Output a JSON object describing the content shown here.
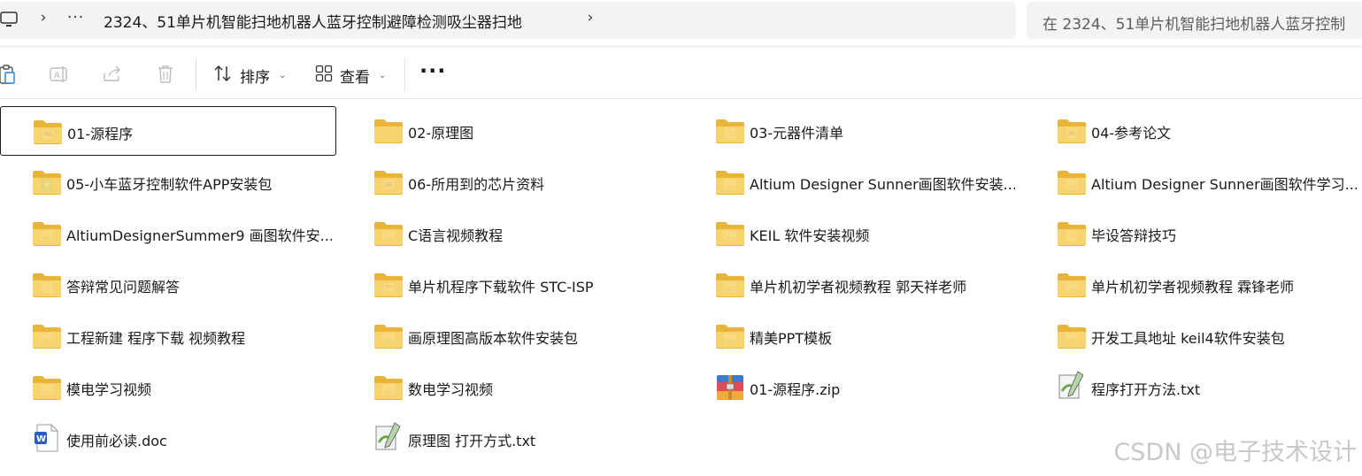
{
  "address_bar": {
    "more_crumbs": "···",
    "current_folder": "2324、51单片机智能扫地机器人蓝牙控制避障检测吸尘器扫地",
    "search_placeholder": "在 2324、51单片机智能扫地机器人蓝牙控制"
  },
  "toolbar": {
    "sort_label": "排序",
    "view_label": "查看",
    "more_label": "···"
  },
  "items": [
    {
      "name": "01-源程序",
      "type": "folder",
      "badge": "blue",
      "selected": true
    },
    {
      "name": "02-原理图",
      "type": "folder",
      "badge": "none"
    },
    {
      "name": "03-元器件清单",
      "type": "folder",
      "badge": "doc"
    },
    {
      "name": "04-参考论文",
      "type": "folder",
      "badge": "blue"
    },
    {
      "name": "05-小车蓝牙控制软件APP安装包",
      "type": "folder",
      "badge": "green"
    },
    {
      "name": "06-所用到的芯片资料",
      "type": "folder",
      "badge": "blue"
    },
    {
      "name": "Altium Designer Sunner画图软件安装...",
      "type": "folder",
      "badge": "image"
    },
    {
      "name": "Altium Designer Sunner画图软件学习...",
      "type": "folder",
      "badge": "image"
    },
    {
      "name": "AltiumDesignerSummer9 画图软件安...",
      "type": "folder",
      "badge": "image"
    },
    {
      "name": "C语言视频教程",
      "type": "folder",
      "badge": "image"
    },
    {
      "name": "KEIL 软件安装视频",
      "type": "folder",
      "badge": "image"
    },
    {
      "name": "毕设答辩技巧",
      "type": "folder",
      "badge": "doc"
    },
    {
      "name": "答辩常见问题解答",
      "type": "folder",
      "badge": "doc"
    },
    {
      "name": "单片机程序下载软件 STC-ISP",
      "type": "folder",
      "badge": "red"
    },
    {
      "name": "单片机初学者视频教程 郭天祥老师",
      "type": "folder",
      "badge": "image"
    },
    {
      "name": "单片机初学者视频教程 霖锋老师",
      "type": "folder",
      "badge": "image"
    },
    {
      "name": "工程新建  程序下载 视频教程",
      "type": "folder",
      "badge": "image"
    },
    {
      "name": "画原理图高版本软件安装包",
      "type": "folder",
      "badge": "image"
    },
    {
      "name": "精美PPT模板",
      "type": "folder",
      "badge": "image"
    },
    {
      "name": "开发工具地址 keil4软件安装包",
      "type": "folder",
      "badge": "image"
    },
    {
      "name": "模电学习视频",
      "type": "folder",
      "badge": "image"
    },
    {
      "name": "数电学习视频",
      "type": "folder",
      "badge": "image"
    },
    {
      "name": "01-源程序.zip",
      "type": "zip"
    },
    {
      "name": "程序打开方法.txt",
      "type": "txt"
    },
    {
      "name": "使用前必读.doc",
      "type": "word"
    },
    {
      "name": "原理图 打开方式.txt",
      "type": "txt"
    }
  ],
  "watermark": "CSDN @电子技术设计",
  "colors": {
    "folder_back": "#e8b53a",
    "folder_front": "#f8d775",
    "selection_border": "#1a1a1a"
  }
}
